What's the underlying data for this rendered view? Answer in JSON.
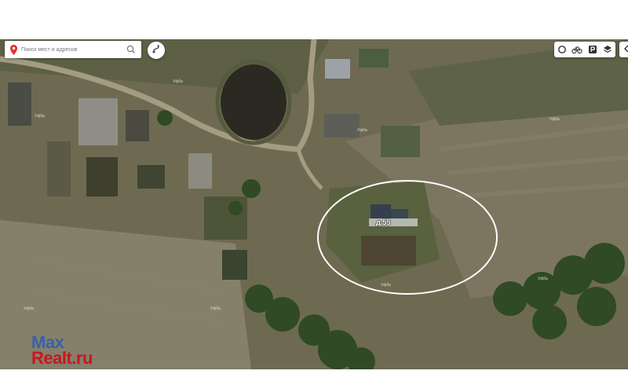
{
  "search": {
    "placeholder": "Поиск мест и адресов"
  },
  "map": {
    "marked_property_label": "д.55",
    "road_labels": [
      "Уфба",
      "Уфба",
      "Уфба",
      "Уфба",
      "Уфба",
      "Уфба",
      "Уфба",
      "Уфба"
    ]
  },
  "controls": {
    "icons": [
      "traffic-icon",
      "bicycle-icon",
      "parking-icon",
      "layers-icon"
    ],
    "expand_icon": "chevron-left-icon"
  },
  "watermark": {
    "line1": "Max",
    "line2": "Realt.ru"
  },
  "colors": {
    "brand_blue": "#3a5fa8",
    "brand_red": "#c8161d",
    "pin_red": "#e5312a",
    "highlight_ellipse": "#ffffff"
  }
}
